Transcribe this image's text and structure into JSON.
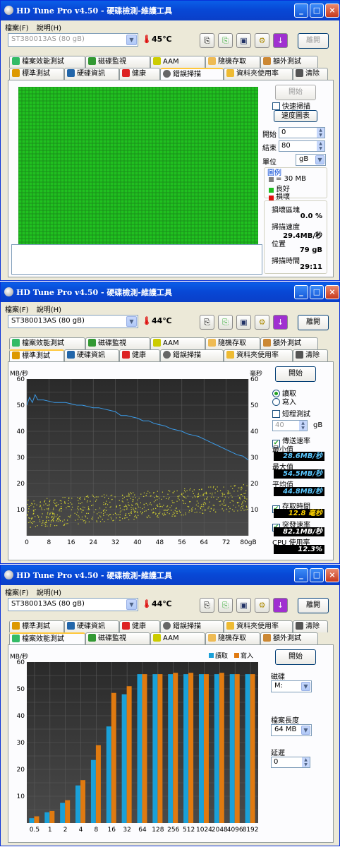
{
  "app": {
    "title": "HD Tune Pro v4.50 - 硬碟檢測-維護工具",
    "window_buttons": [
      "_",
      "□",
      "×"
    ],
    "menu": [
      "檔案(F)",
      "說明(H)"
    ],
    "drive": "ST380013AS (80 gB)",
    "exit_label": "離開",
    "toolbar_icons": [
      "copy-icon",
      "copy-text-icon",
      "save-icon",
      "options-icon",
      "download-icon"
    ]
  },
  "tabs_top_row": [
    "檔案效能測試",
    "磁碟監視",
    "AAM",
    "隨機存取",
    "額外測試"
  ],
  "tabs_bottom_row": [
    "標準測試",
    "硬碟資訊",
    "健康",
    "錯誤掃描",
    "資料夾使用率",
    "清除"
  ],
  "window1": {
    "temperature": "45℃",
    "active_tab": "錯誤掃描",
    "start_label": "開始",
    "quick_scan_label": "快速掃描",
    "speed_map_label": "速度圖表",
    "start_field_label": "開始",
    "start_value": "0",
    "end_field_label": "結束",
    "end_value": "80",
    "unit_label": "單位",
    "unit_value": "gB",
    "legend_title": "圖例",
    "legend": [
      {
        "label": "= 30 MB",
        "color": "#808080"
      },
      {
        "label": "良好",
        "color": "#20c020"
      },
      {
        "label": "損壞",
        "color": "#e01010"
      }
    ],
    "damaged_label": "損壞區塊",
    "damaged_value": "0.0 %",
    "speed_label": "掃描速度",
    "speed_value": "29.4MB/秒",
    "position_label": "位置",
    "position_value": "79 gB",
    "time_label": "掃描時間",
    "time_value": "29:11"
  },
  "window2": {
    "temperature": "44℃",
    "active_tab": "標準測試",
    "start_label": "開始",
    "read_label": "讀取",
    "write_label": "寫入",
    "short_test_label": "短程測試",
    "short_value": "40",
    "short_unit": "gB",
    "transfer_label": "傳送速率",
    "min_label": "最小值",
    "min_value": "28.6MB/秒",
    "max_label": "最大值",
    "max_value": "54.5MB/秒",
    "avg_label": "平均值",
    "avg_value": "44.8MB/秒",
    "access_label": "存取時間",
    "access_value": "12.8 毫秒",
    "burst_label": "突發速率",
    "burst_value": "82.1MB/秒",
    "cpu_label": "CPU 使用率",
    "cpu_value": "12.3%"
  },
  "window3": {
    "temperature": "44℃",
    "active_tab": "檔案效能測試",
    "start_label": "開始",
    "drive_label": "磁碟",
    "drive_value": "M:",
    "file_length_label": "檔案長度",
    "file_length_value": "64 MB",
    "delay_label": "延遲",
    "delay_value": "0"
  },
  "chart_data": [
    {
      "type": "line",
      "ylabel": "MB/秒",
      "y2label": "毫秒",
      "xunit": "gB",
      "xlim": [
        0,
        80
      ],
      "ylim": [
        0,
        60
      ],
      "y2lim": [
        0,
        60
      ],
      "xticks": [
        0,
        8,
        16,
        24,
        32,
        40,
        48,
        56,
        64,
        72,
        80
      ],
      "xtick_labels": [
        "0",
        "8",
        "16",
        "24",
        "32",
        "40",
        "48",
        "56",
        "64",
        "72",
        "80gB"
      ],
      "yticks": [
        10,
        20,
        30,
        40,
        50,
        60
      ],
      "grid": true,
      "series": [
        {
          "color": "#3b9be8",
          "x": [
            0,
            1,
            2,
            3,
            4,
            6,
            8,
            10,
            12,
            14,
            16,
            18,
            20,
            22,
            24,
            26,
            28,
            30,
            32,
            34,
            36,
            38,
            40,
            42,
            44,
            46,
            48,
            50,
            52,
            54,
            56,
            58,
            60,
            62,
            64,
            66,
            68,
            70,
            72,
            74,
            76,
            78,
            80
          ],
          "y": [
            50,
            53,
            51,
            54,
            52,
            52,
            51.5,
            51,
            51,
            51,
            50.5,
            50,
            50,
            49.5,
            49,
            49,
            48.5,
            48,
            47.5,
            46,
            46,
            45.5,
            45,
            44,
            44,
            43,
            42.5,
            42,
            41,
            40.5,
            40,
            39,
            38.5,
            38,
            37,
            36,
            35,
            34,
            33,
            32,
            31,
            30.5,
            29
          ]
        }
      ],
      "scatter": {
        "color": "#d8d830",
        "y_range_start": [
          3,
          14
        ],
        "y_range_end": [
          10,
          20
        ]
      }
    },
    {
      "type": "bar",
      "ylabel": "MB/秒",
      "ylim": [
        0,
        60
      ],
      "yticks": [
        10,
        20,
        30,
        40,
        50,
        60
      ],
      "legend_position": "top-right",
      "categories": [
        "0.5",
        "1",
        "2",
        "4",
        "8",
        "16",
        "32",
        "64",
        "128",
        "256",
        "512",
        "1024",
        "2048",
        "4096",
        "8192"
      ],
      "series": [
        {
          "name": "讀取",
          "color": "#1aa0d8",
          "values": [
            1.8,
            4,
            7.5,
            14,
            23.5,
            36,
            48,
            55.5,
            55.5,
            55.5,
            55.5,
            55.5,
            55.5,
            55.5,
            55.5
          ]
        },
        {
          "name": "寫入",
          "color": "#e07a10",
          "values": [
            2.5,
            4.5,
            8.5,
            16,
            29,
            48.5,
            51,
            55.5,
            55.5,
            56,
            56,
            55.5,
            56,
            55.5,
            55.5
          ]
        }
      ]
    }
  ]
}
